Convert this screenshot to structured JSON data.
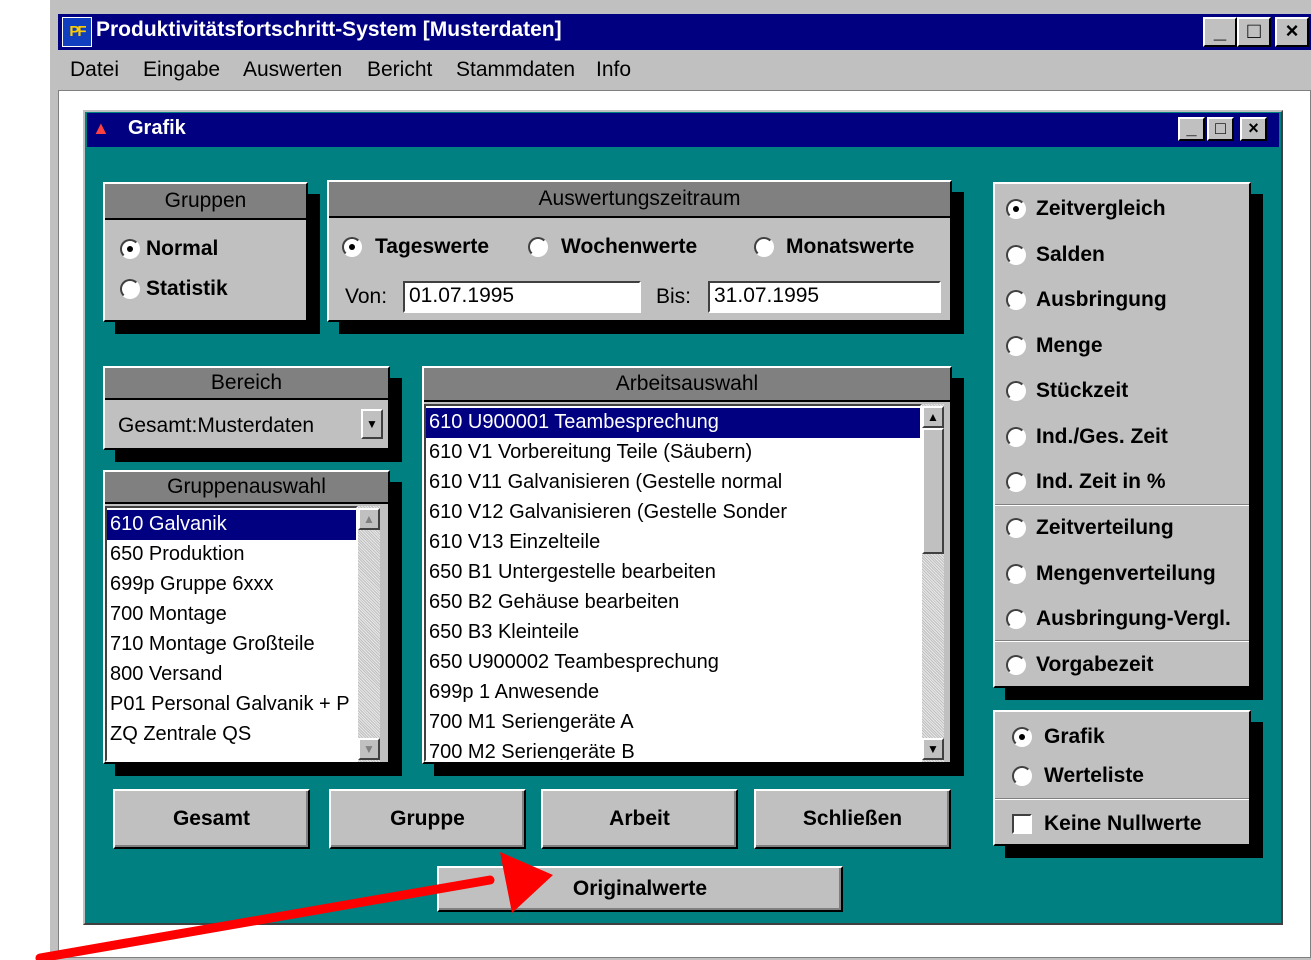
{
  "app": {
    "title": "Produktivitätsfortschritt-System [Musterdaten]",
    "logo_text": "PF",
    "controls": [
      "_",
      "□",
      "×"
    ]
  },
  "menu": [
    {
      "label": "Datei"
    },
    {
      "label": "Eingabe"
    },
    {
      "label": "Auswerten"
    },
    {
      "label": "Bericht"
    },
    {
      "label": "Stammdaten"
    },
    {
      "label": "Info"
    }
  ],
  "child": {
    "title": "Grafik",
    "controls": [
      "_",
      "□",
      "×"
    ]
  },
  "gruppen": {
    "heading": "Gruppen",
    "options": [
      {
        "label": "Normal",
        "selected": true
      },
      {
        "label": "Statistik",
        "selected": false
      }
    ]
  },
  "zeitraum": {
    "heading": "Auswertungszeitraum",
    "options": [
      {
        "label": "Tageswerte",
        "selected": true
      },
      {
        "label": "Wochenwerte",
        "selected": false
      },
      {
        "label": "Monatswerte",
        "selected": false
      }
    ],
    "von_label": "Von:",
    "von_value": "01.07.1995",
    "bis_label": "Bis:",
    "bis_value": "31.07.1995"
  },
  "bereich": {
    "heading": "Bereich",
    "selected": "Gesamt:Musterdaten"
  },
  "gruppenauswahl": {
    "heading": "Gruppenauswahl",
    "items": [
      "610 Galvanik",
      "650 Produktion",
      "699p Gruppe 6xxx",
      "700 Montage",
      "710 Montage Großteile",
      "800 Versand",
      "P01 Personal Galvanik + P",
      "ZQ Zentrale QS"
    ],
    "selected_index": 0
  },
  "arbeitsauswahl": {
    "heading": "Arbeitsauswahl",
    "items": [
      "610 U900001 Teambesprechung",
      "610 V1 Vorbereitung Teile (Säubern)",
      "610 V11 Galvanisieren (Gestelle normal",
      "610 V12 Galvanisieren (Gestelle Sonder",
      "610 V13 Einzelteile",
      "650 B1 Untergestelle bearbeiten",
      "650 B2 Gehäuse bearbeiten",
      "650 B3 Kleinteile",
      "650 U900002 Teambesprechung",
      "699p 1 Anwesende",
      "700 M1 Seriengeräte  A",
      "700 M2 Seriengeräte B"
    ],
    "selected_index": 0
  },
  "auswertung": {
    "options": [
      {
        "label": "Zeitvergleich",
        "selected": true
      },
      {
        "label": "Salden",
        "selected": false
      },
      {
        "label": "Ausbringung",
        "selected": false
      },
      {
        "label": "Menge",
        "selected": false
      },
      {
        "label": "Stückzeit",
        "selected": false
      },
      {
        "label": "Ind./Ges. Zeit",
        "selected": false
      },
      {
        "label": "Ind. Zeit in %",
        "selected": false
      },
      {
        "label": "Zeitverteilung",
        "selected": false
      },
      {
        "label": "Mengenverteilung",
        "selected": false
      },
      {
        "label": "Ausbringung-Vergl.",
        "selected": false
      },
      {
        "label": "Vorgabezeit",
        "selected": false
      }
    ]
  },
  "ausgabe": {
    "options": [
      {
        "label": "Grafik",
        "selected": true
      },
      {
        "label": "Werteliste",
        "selected": false
      }
    ],
    "checkbox_label": "Keine Nullwerte",
    "checkbox_checked": false
  },
  "buttons": {
    "gesamt": "Gesamt",
    "gruppe": "Gruppe",
    "arbeit": "Arbeit",
    "schliessen": "Schließen",
    "originalwerte": "Originalwerte"
  },
  "colors": {
    "titlebar": "#000080",
    "dialog_bg": "#008080",
    "panel": "#c0c0c0",
    "annotation_arrow": "#ff0000"
  }
}
